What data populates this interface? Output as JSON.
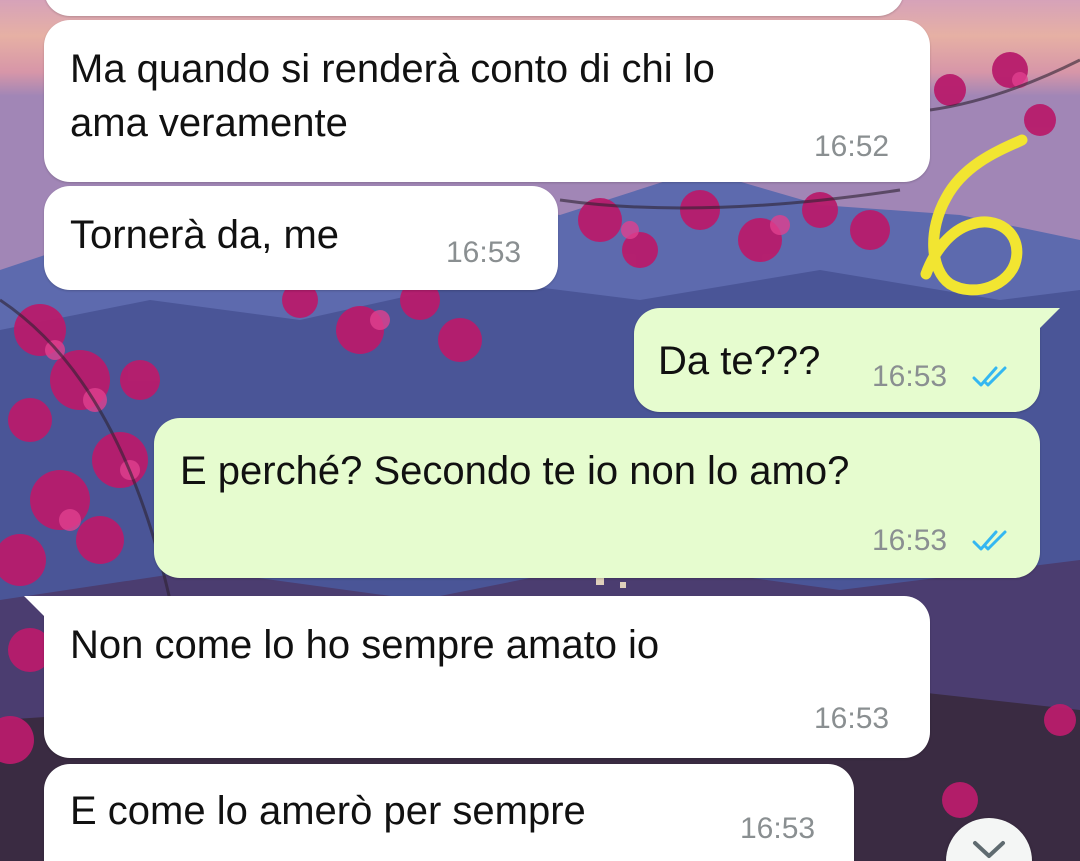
{
  "chat": {
    "messages": [
      {
        "direction": "incoming",
        "text_line1": "Ma quando si renderà conto di chi lo",
        "text_line2": "ama veramente",
        "time": "16:52"
      },
      {
        "direction": "incoming",
        "text": "Tornerà da, me",
        "time": "16:53"
      },
      {
        "direction": "outgoing",
        "text": "Da te???",
        "time": "16:53",
        "status": "read"
      },
      {
        "direction": "outgoing",
        "text": "E perché? Secondo te io non lo amo?",
        "time": "16:53",
        "status": "read"
      },
      {
        "direction": "incoming",
        "text": "Non come lo ho sempre amato io",
        "time": "16:53"
      },
      {
        "direction": "incoming",
        "text": "E come lo amerò per sempre",
        "time": "16:53"
      }
    ]
  },
  "annotation": {
    "text": "6",
    "color": "#f2e531"
  },
  "icons": {
    "read_receipt": "double-check-icon",
    "scroll_down": "chevron-down-icon"
  },
  "colors": {
    "incoming_bubble": "#ffffff",
    "outgoing_bubble": "#e6fccf",
    "timestamp": "#8a8f91",
    "read_ticks": "#34b7f1"
  }
}
